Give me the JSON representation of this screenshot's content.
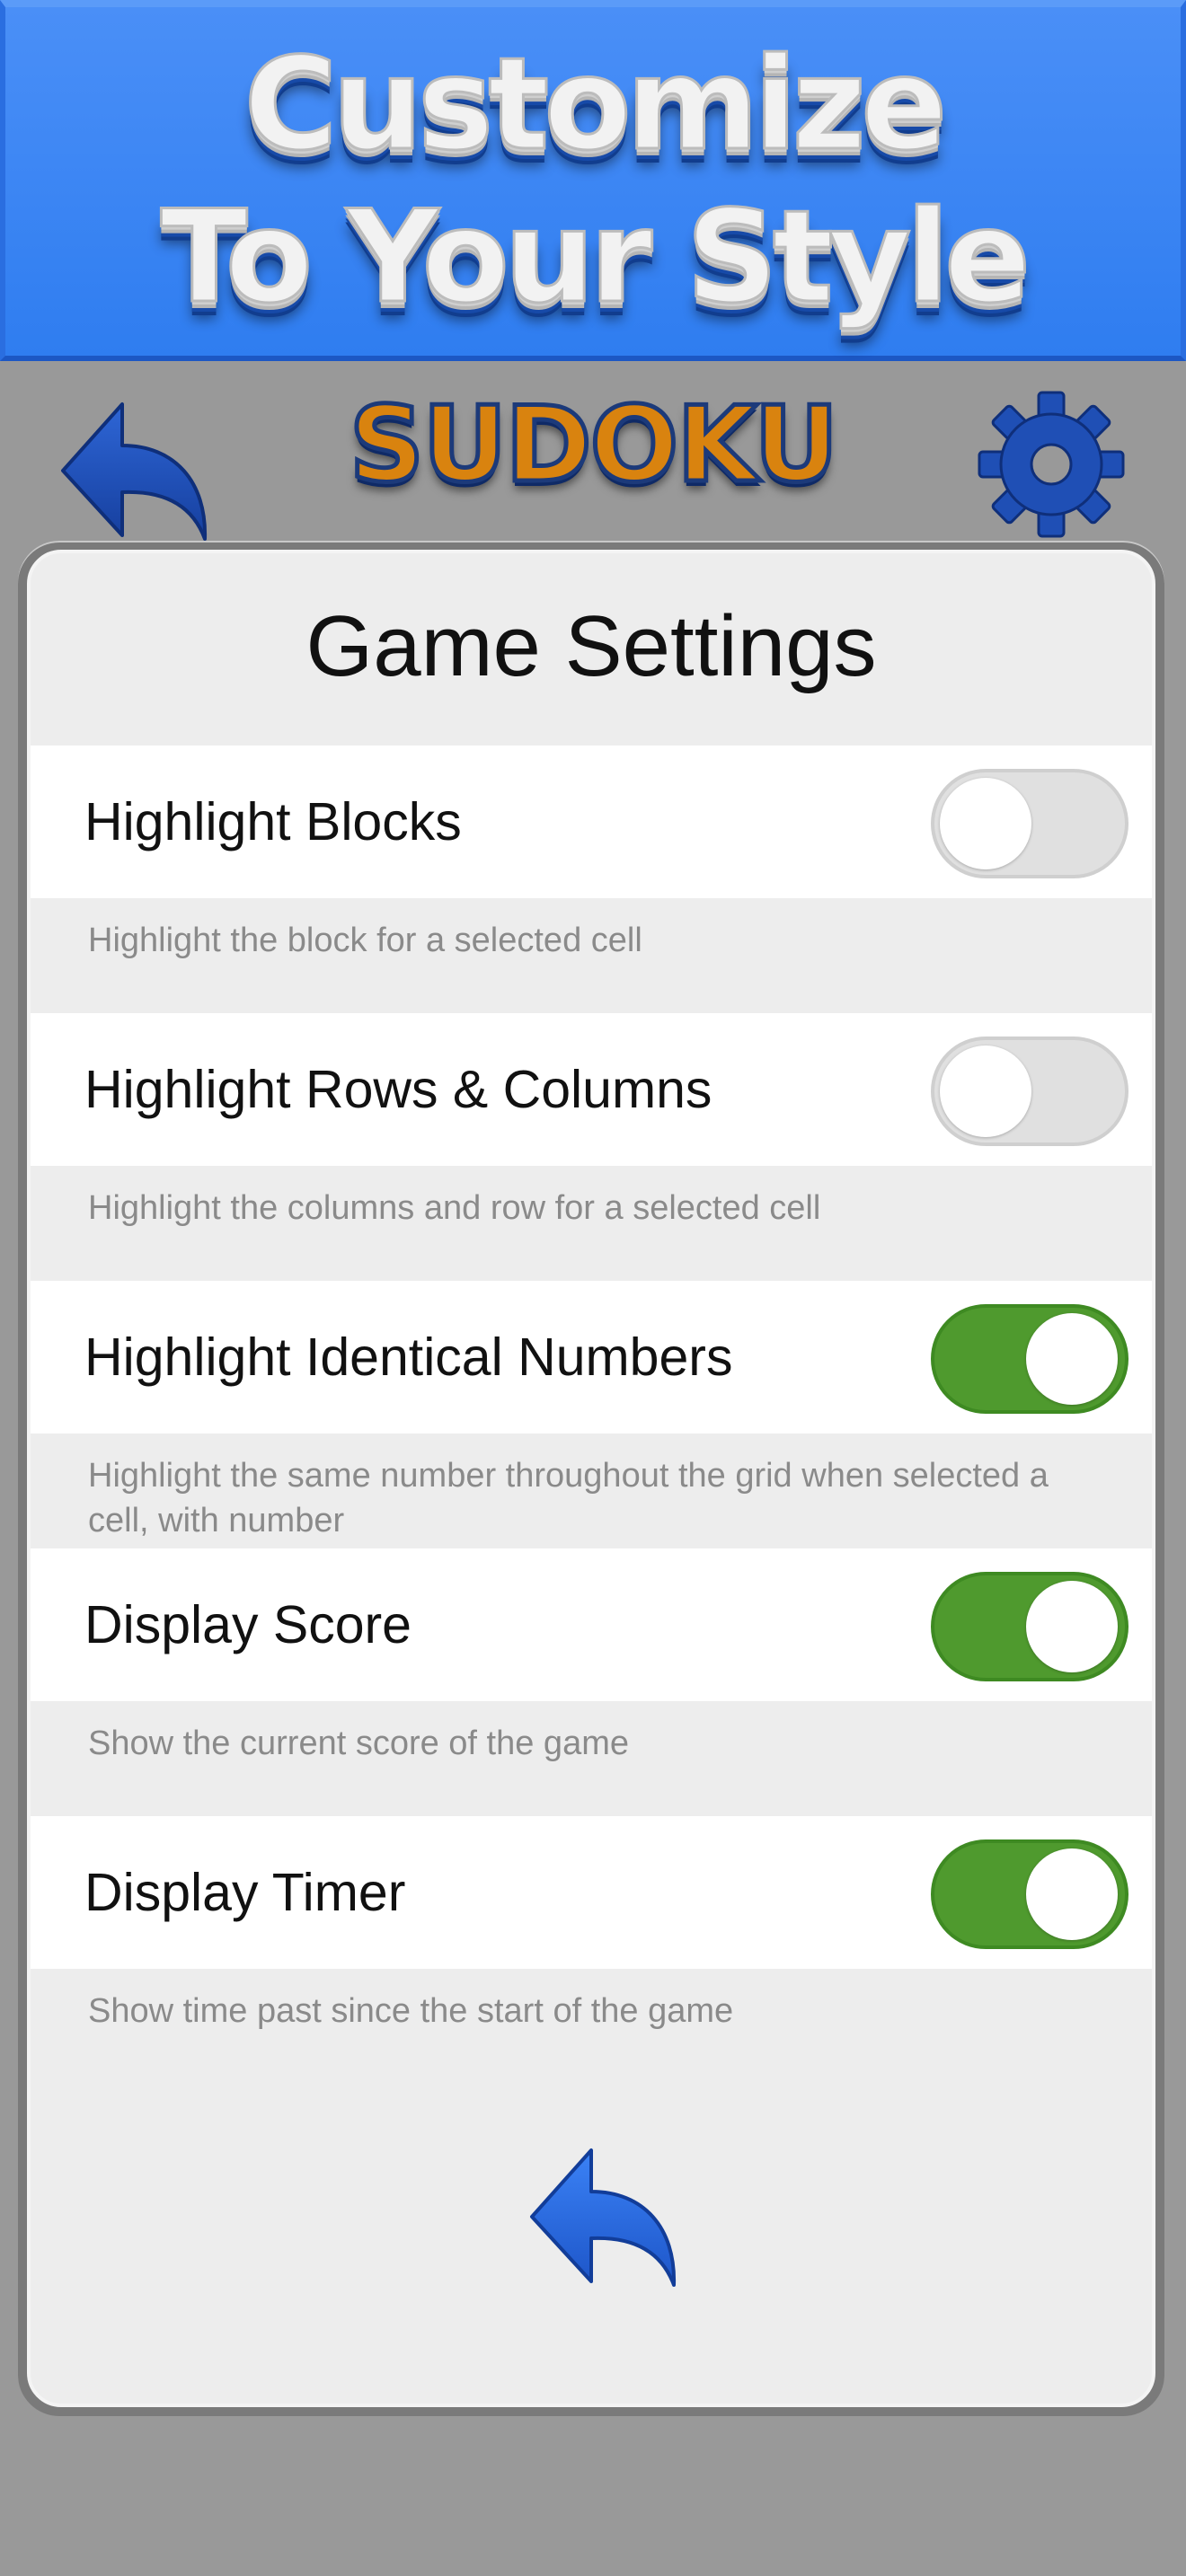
{
  "banner": {
    "line1": "Customize",
    "line2": "To Your Style"
  },
  "header": {
    "logo": "SUDOKU",
    "back_icon": "back-arrow-icon",
    "settings_icon": "gear-icon"
  },
  "panel": {
    "title": "Game Settings",
    "settings": [
      {
        "label": "Highlight Blocks",
        "description": "Highlight the block for a selected cell",
        "enabled": false
      },
      {
        "label": "Highlight Rows & Columns",
        "description": "Highlight the columns and row for a selected cell",
        "enabled": false
      },
      {
        "label": "Highlight Identical Numbers",
        "description": "Highlight the same number throughout the grid when selected a cell, with number",
        "enabled": true
      },
      {
        "label": "Display Score",
        "description": "Show the current score of the game",
        "enabled": true
      },
      {
        "label": "Display Timer",
        "description": "Show time past since the start of the game",
        "enabled": true
      }
    ],
    "back_icon": "back-arrow-icon"
  },
  "colors": {
    "banner_blue": "#2f7df0",
    "toggle_on": "#4f9a2e",
    "toggle_off": "#e0e0e0",
    "logo_orange": "#d9830f",
    "icon_blue": "#1f4fb5"
  }
}
